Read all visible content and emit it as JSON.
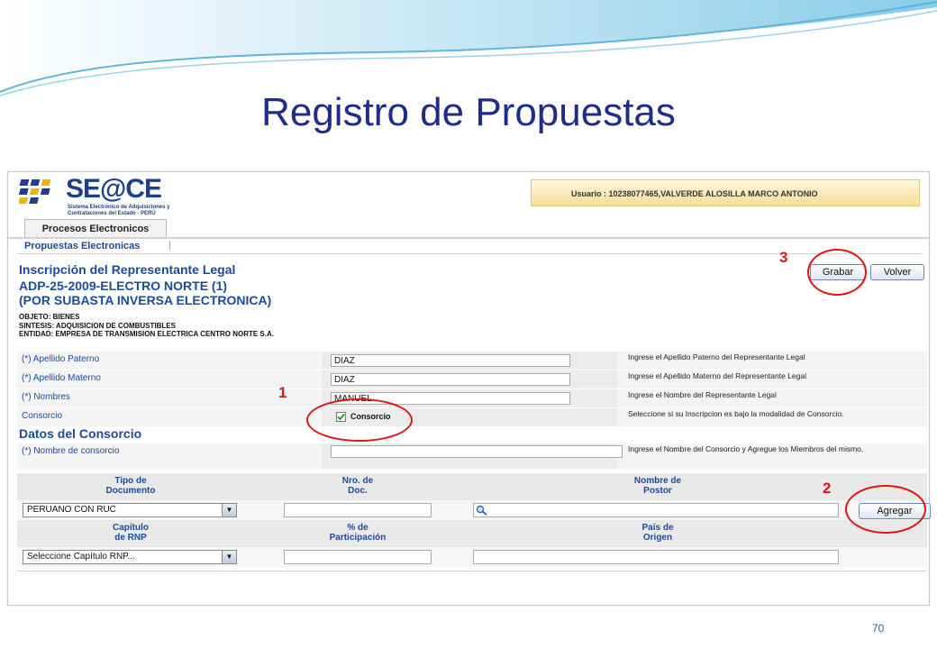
{
  "slide": {
    "title": "Registro de Propuestas",
    "page_number": "70"
  },
  "header": {
    "logo_text": "SE@CE",
    "logo_subtitle": "Sistema Electrónico de Adquisiciones y Contrataciones del Estado - PERÚ",
    "user_label": "Usuario :",
    "user_value": "10238077465,VALVERDE ALOSILLA MARCO ANTONIO"
  },
  "nav": {
    "tab": "Procesos Electronicos",
    "subtab": "Propuestas Electronicas",
    "separator": "|"
  },
  "section": {
    "title": "Inscripción del Representante Legal",
    "process_line1": "ADP-25-2009-ELECTRO NORTE (1)",
    "process_line2": "(POR SUBASTA INVERSA ELECTRONICA)",
    "objeto": "OBJETO: BIENES",
    "sintesis": "SINTESIS: ADQUISICION DE COMBUSTIBLES",
    "entidad": "ENTIDAD: EMPRESA DE TRANSMISION ELECTRICA CENTRO NORTE S.A."
  },
  "buttons": {
    "grabar": "Grabar",
    "volver": "Volver",
    "agregar": "Agregar"
  },
  "form": {
    "apellido_paterno": {
      "label": "(*) Apellido Paterno",
      "value": "DIAZ",
      "hint": "Ingrese el Apellido Paterno del Representante Legal"
    },
    "apellido_materno": {
      "label": "(*) Apellido Materno",
      "value": "DIAZ",
      "hint": "Ingrese el Apellido Materno del Representante Legal"
    },
    "nombres": {
      "label": "(*) Nombres",
      "value": "MANUEL",
      "hint": "Ingrese el Nombre del Representante Legal"
    },
    "consorcio": {
      "label": "Consorcio",
      "checkbox_label": "Consorcio",
      "checked": true,
      "hint": "Seleccione si su Inscripcion es bajo la modalidad de Consorcio."
    }
  },
  "consorcio_section": {
    "title": "Datos del Consorcio",
    "nombre_label": "(*) Nombre de consorcio",
    "nombre_value": "",
    "nombre_hint": "Ingrese el Nombre del Consorcio y Agregue los Miembros del mismo."
  },
  "grid": {
    "headers1": [
      "Tipo de\nDocumento",
      "Nro. de\nDoc.",
      "Nombre de\nPostor"
    ],
    "headers2": [
      "Capítulo\nde RNP",
      "% de\nParticipación",
      "País de\nOrigen"
    ],
    "tipo_documento": "PERUANO CON RUC",
    "capitulo_rnp": "Seleccione Capítulo RNP..."
  },
  "annotations": [
    "1",
    "2",
    "3"
  ],
  "colors": {
    "title_blue": "#1f2d8a",
    "link_blue": "#1b4a9e",
    "annotation_red": "#e01515"
  }
}
